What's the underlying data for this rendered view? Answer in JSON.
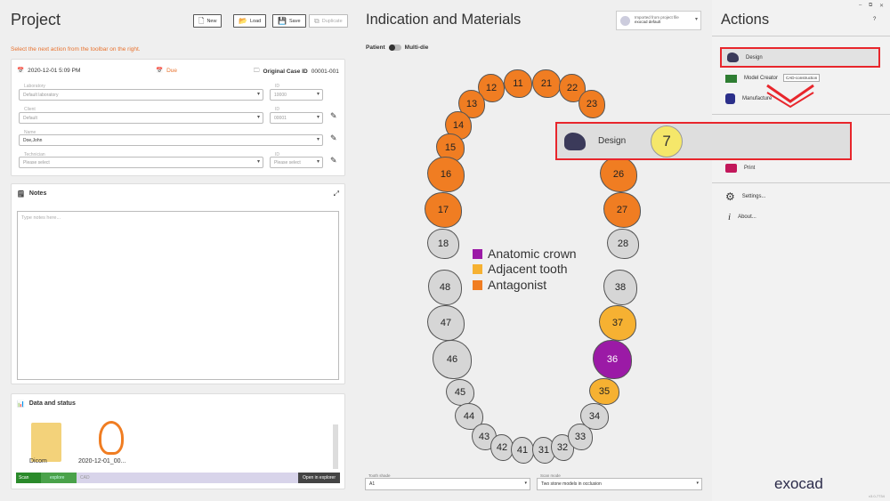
{
  "project": {
    "title": "Project",
    "hint": "Select the next action from the toolbar on the right.",
    "buttons": {
      "new": "New",
      "load": "Load",
      "save": "Save",
      "duplicate": "Duplicate"
    },
    "date": "2020-12-01 5:09 PM",
    "due": "Due",
    "case_label": "Original Case ID",
    "case_id": "00001-001",
    "fields": {
      "lab_label": "Laboratory",
      "lab_value": "Default laboratory",
      "lab_id_label": "ID",
      "lab_id": "10000",
      "client_label": "Client",
      "client_value": "Default",
      "client_id_label": "ID",
      "client_id": "00001",
      "name_label": "Name",
      "name_value": "Doe,John",
      "tech_label": "Technician",
      "tech_value": "Please select",
      "tech_id_label": "ID",
      "tech_id": "Please select"
    },
    "notes_title": "Notes",
    "notes_placeholder": "Type notes here...",
    "data_title": "Data and status",
    "files": [
      {
        "label": "Dicom"
      },
      {
        "label": "2020-12-01_00..."
      }
    ],
    "status": {
      "scan": "Scan",
      "explore": "explore",
      "cad": "CAD",
      "open_explorer": "Open in explorer"
    }
  },
  "mid": {
    "title": "Indication and Materials",
    "import_line1": "Imported from project file",
    "import_line2": "exocad default",
    "patient": "Patient",
    "multidie": "Multi-die",
    "legend": [
      {
        "label": "Anatomic crown",
        "color": "#9b1aa6"
      },
      {
        "label": "Adjacent tooth",
        "color": "#f6b132"
      },
      {
        "label": "Antagonist",
        "color": "#f07d22"
      }
    ],
    "shade_label": "Tooth shade",
    "shade_value": "A1",
    "scanmode_label": "Scan mode",
    "scanmode_value": "Two stone models in occlusion",
    "teeth": {
      "t11": "11",
      "t12": "12",
      "t13": "13",
      "t14": "14",
      "t15": "15",
      "t16": "16",
      "t17": "17",
      "t18": "18",
      "t21": "21",
      "t22": "22",
      "t23": "23",
      "t26": "26",
      "t27": "27",
      "t28": "28",
      "t31": "31",
      "t32": "32",
      "t33": "33",
      "t34": "34",
      "t35": "35",
      "t36": "36",
      "t37": "37",
      "t38": "38",
      "t41": "41",
      "t42": "42",
      "t43": "43",
      "t44": "44",
      "t45": "45",
      "t46": "46",
      "t47": "47",
      "t48": "48"
    }
  },
  "actions": {
    "title": "Actions",
    "help": "?",
    "design": "Design",
    "model_creator": "Model Creator",
    "cad_tooltip": "CAD-construction",
    "manufacture": "Manufacture",
    "print": "Print",
    "settings": "Settings...",
    "about": "About...",
    "brand": "exocad",
    "version": "v3.0-7734"
  },
  "overlay": {
    "label": "Design",
    "step": "7"
  }
}
